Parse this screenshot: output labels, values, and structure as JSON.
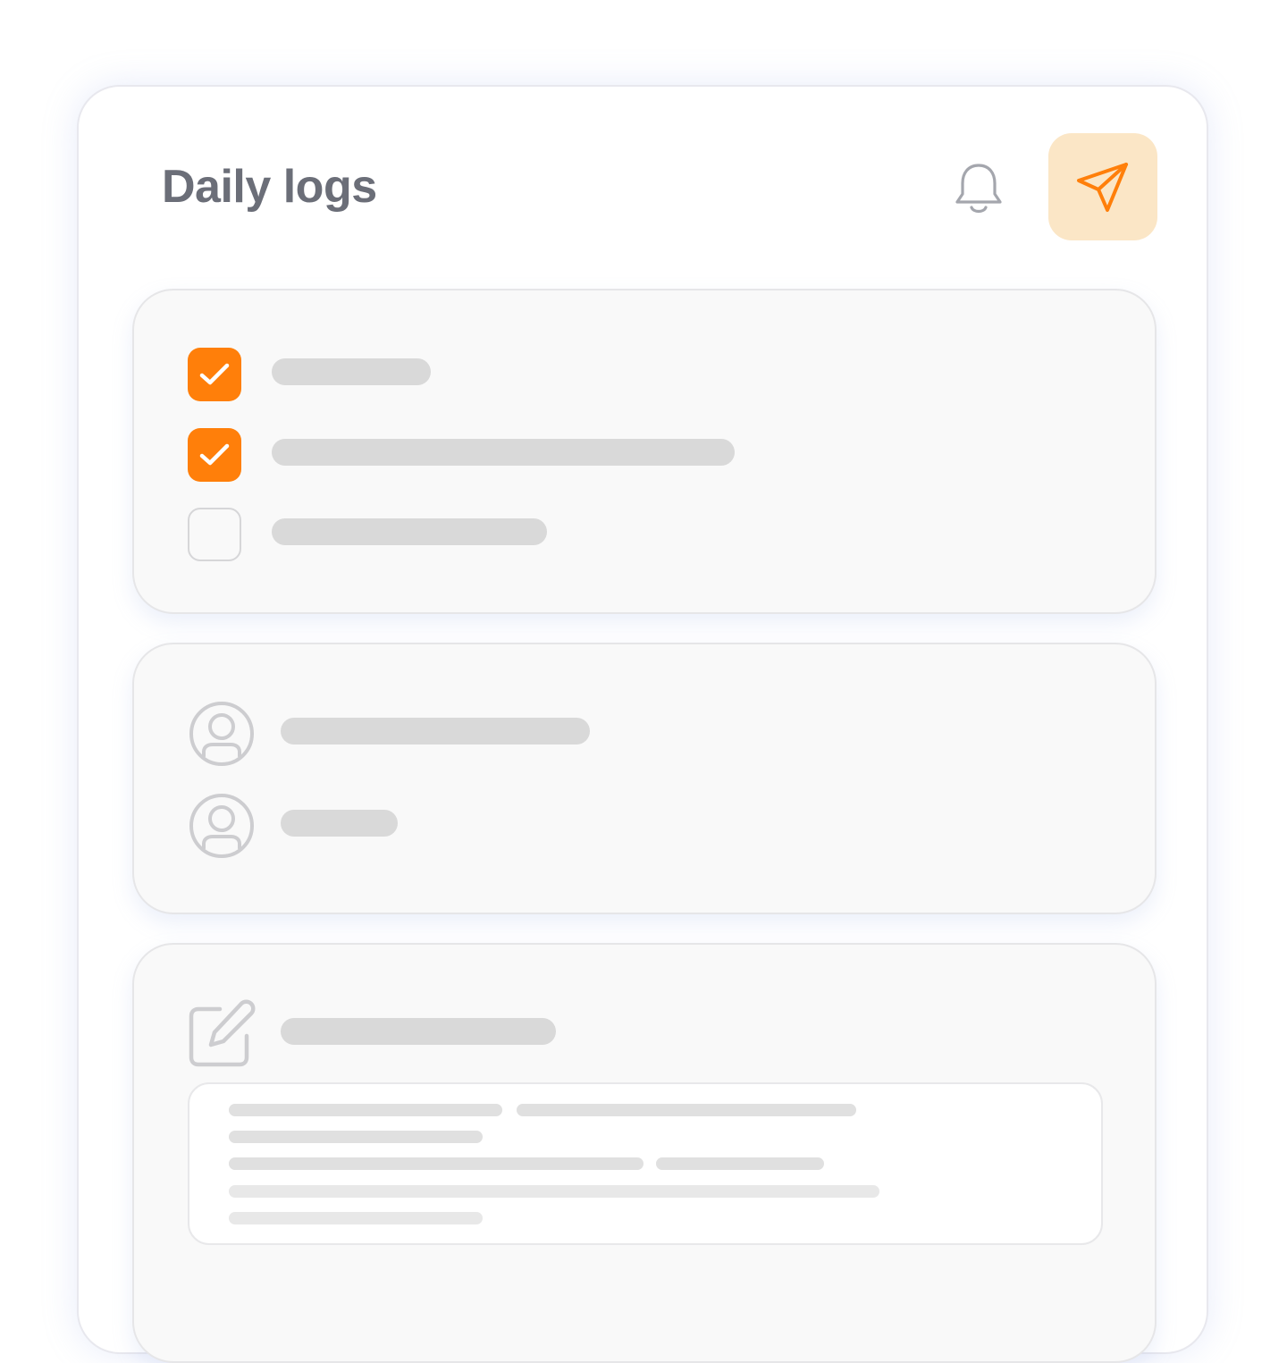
{
  "header": {
    "title": "Daily logs",
    "bell_icon": "bell-icon",
    "send_icon": "send-icon"
  },
  "colors": {
    "accent": "#ff7f0a",
    "accent_soft": "#fbe6c6",
    "title": "#6b6e78",
    "placeholder": "#d9d9d9",
    "card_bg": "#f9f9f9"
  },
  "checklist": {
    "items": [
      {
        "checked": true
      },
      {
        "checked": true
      },
      {
        "checked": false
      }
    ]
  },
  "people": {
    "icon": "user-circle-icon",
    "count": 2
  },
  "notes": {
    "icon": "edit-icon"
  }
}
